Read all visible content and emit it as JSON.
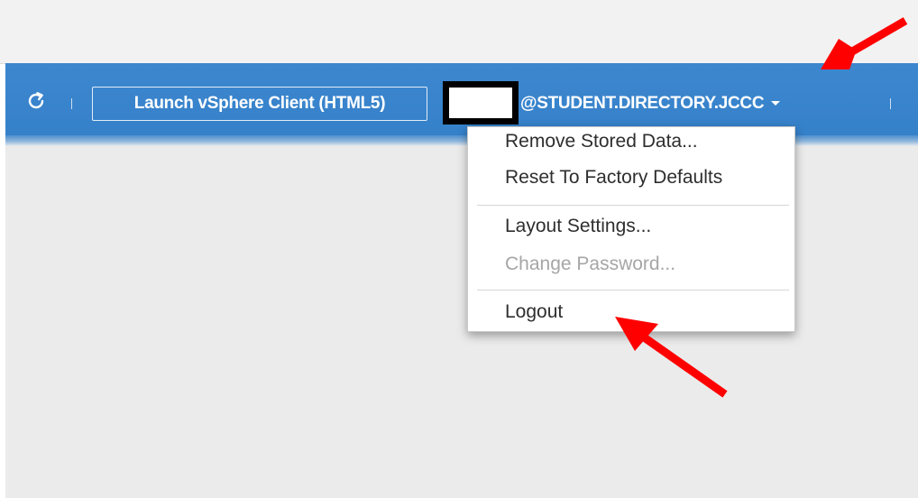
{
  "toolbar": {
    "refresh_icon": "refresh-icon",
    "launch_button_label": "Launch vSphere Client (HTML5)",
    "user_label": "@STUDENT.DIRECTORY.JCCC",
    "user_caret_icon": "caret-down-icon",
    "bar_color": "#3a85cc"
  },
  "user_dropdown": {
    "items": [
      {
        "label": "Remove Stored Data...",
        "enabled": true
      },
      {
        "label": "Reset To Factory Defaults",
        "enabled": true
      },
      {
        "label": "Layout Settings...",
        "enabled": true
      },
      {
        "label": "Change Password...",
        "enabled": false
      },
      {
        "label": "Logout",
        "enabled": true
      }
    ]
  },
  "annotations": {
    "arrow_color": "#ff0000",
    "arrows": [
      "arrow-to-user-menu",
      "arrow-to-logout"
    ]
  }
}
